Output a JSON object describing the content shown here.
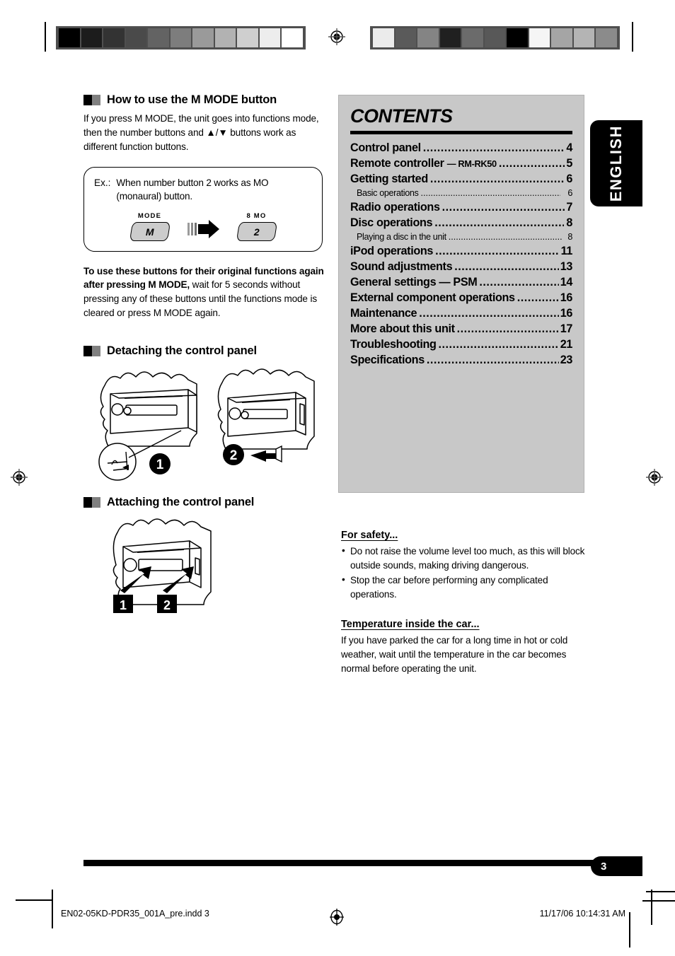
{
  "language_tab": {
    "label": "ENGLISH"
  },
  "left_column": {
    "section1": {
      "heading": "How to use the M MODE button",
      "intro": "If you press M MODE, the unit goes into functions mode, then the number buttons and ▲/▼ buttons work as different function buttons.",
      "example_box": {
        "label": "Ex.:",
        "text": "When number button 2 works as MO (monaural) button.",
        "left_key_caption": "MODE",
        "left_key_glyph": "M",
        "right_key_caption": "8 MO",
        "right_key_glyph": "2"
      },
      "note_bold": "To use these buttons for their original functions again after pressing M MODE,",
      "note_rest": " wait for 5 seconds without pressing any of these buttons until the functions mode is cleared or press M MODE again."
    },
    "section2": {
      "heading": "Detaching the control panel",
      "step1": "1",
      "step2": "2"
    },
    "section3": {
      "heading": "Attaching the control panel",
      "step1": "1",
      "step2": "2"
    }
  },
  "contents": {
    "title": "CONTENTS",
    "entries": [
      {
        "title": "Control panel",
        "sub": "",
        "page": "4",
        "level": 1
      },
      {
        "title": "Remote controller ",
        "sub": "— RM-RK50",
        "page": "5",
        "level": 1
      },
      {
        "title": "Getting started",
        "sub": "",
        "page": "6",
        "level": 1
      },
      {
        "title": "Basic operations",
        "sub": "",
        "page": "6",
        "level": 2
      },
      {
        "title": "Radio operations",
        "sub": "",
        "page": "7",
        "level": 1
      },
      {
        "title": "Disc operations",
        "sub": "",
        "page": "8",
        "level": 1
      },
      {
        "title": "Playing a disc in the unit",
        "sub": "",
        "page": "8",
        "level": 2
      },
      {
        "title": "iPod operations",
        "sub": "",
        "page": "11",
        "level": 1
      },
      {
        "title": "Sound adjustments",
        "sub": "",
        "page": "13",
        "level": 1
      },
      {
        "title": "General settings — PSM",
        "sub": "",
        "page": "14",
        "level": 1
      },
      {
        "title": "External component operations",
        "sub": "",
        "page": "16",
        "level": 1
      },
      {
        "title": "Maintenance",
        "sub": "",
        "page": "16",
        "level": 1
      },
      {
        "title": "More about this unit",
        "sub": "",
        "page": "17",
        "level": 1
      },
      {
        "title": "Troubleshooting",
        "sub": "",
        "page": "21",
        "level": 1
      },
      {
        "title": "Specifications",
        "sub": "",
        "page": "23",
        "level": 1
      }
    ]
  },
  "safety": {
    "heading1": "For safety...",
    "bullets": [
      "Do not raise the volume level too much, as this will block outside sounds, making driving dangerous.",
      "Stop the car before performing any complicated operations."
    ],
    "heading2": "Temperature inside the car...",
    "paragraph": "If you have parked the car for a long time in hot or cold weather, wait until the temperature in the car becomes normal before operating the unit."
  },
  "footer": {
    "page_number": "3",
    "file_name": "EN02-05KD-PDR35_001A_pre.indd   3",
    "timestamp": "11/17/06   10:14:31 AM"
  },
  "calibration": {
    "left_wedge": [
      "#000000",
      "#1c1c1c",
      "#333333",
      "#4a4a4a",
      "#636363",
      "#7d7d7d",
      "#9a9a9a",
      "#b2b2b2",
      "#cfcfcf",
      "#ededed",
      "#ffffff"
    ],
    "right_wedge": [
      "#ebebeb",
      "#5a5a5a",
      "#848484",
      "#202020",
      "#6b6b6b",
      "#585858",
      "#000000",
      "#f5f5f5",
      "#a5a5a5",
      "#b4b4b4",
      "#8b8b8b"
    ]
  }
}
